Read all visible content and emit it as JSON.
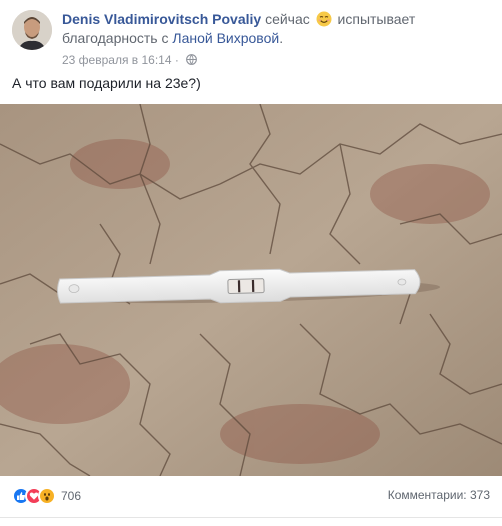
{
  "post": {
    "author_name": "Denis Vladimirovitsch Povaliy",
    "activity_now": "сейчас",
    "activity_verb": "испытывает",
    "activity_feeling": "благодарность с",
    "tagged_person": "Ланой Вихровой",
    "period": ".",
    "timestamp": "23 февраля в 16:14",
    "separator": "·",
    "text": "А что вам подарили на 23е?)",
    "feeling_icon": "grateful-emoji-icon",
    "privacy_icon": "globe-icon"
  },
  "footer": {
    "reaction_icons": [
      "like-icon",
      "love-icon",
      "wow-icon"
    ],
    "reaction_count": "706",
    "comments_label": "Комментарии: 373"
  },
  "colors": {
    "link": "#385898",
    "like": "#1877f2",
    "love": "#f33e58",
    "wow": "#f7b125"
  }
}
